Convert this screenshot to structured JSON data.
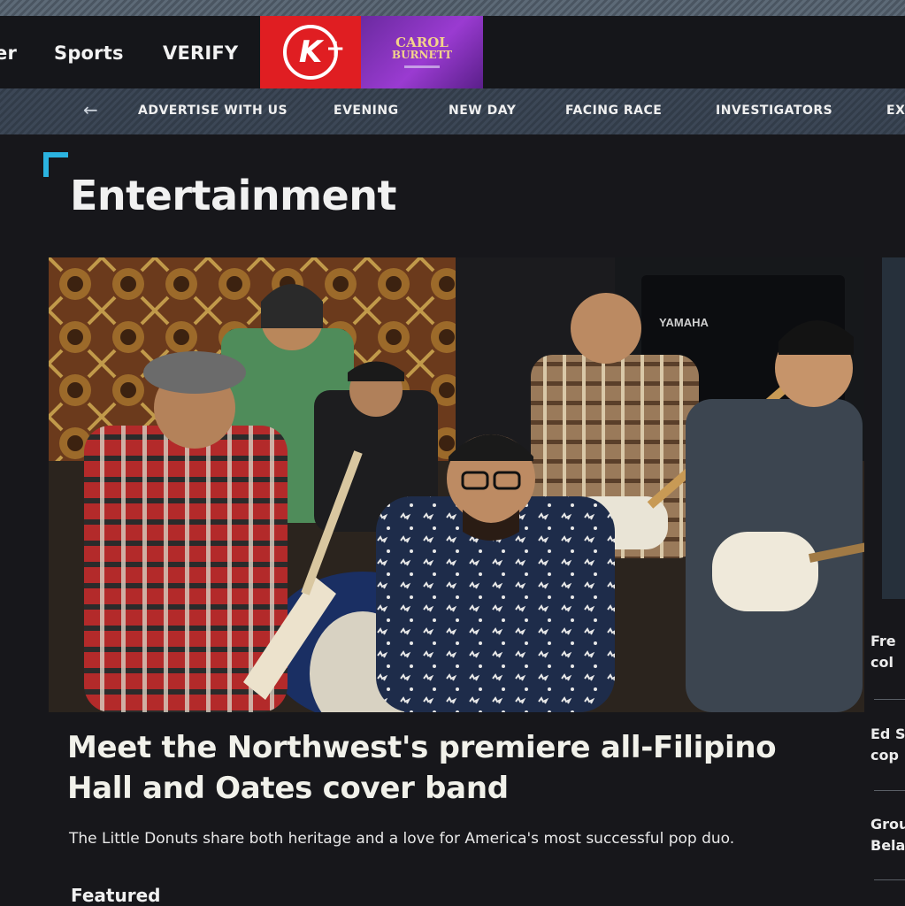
{
  "main_nav": {
    "cut_item": "er",
    "items": [
      "Sports",
      "VERIFY"
    ],
    "kplus_label": "K",
    "kplus_plus": "+",
    "promo_line1": "CAROL",
    "promo_line2": "BURNETT"
  },
  "sub_nav": {
    "items": [
      "ADVERTISE WITH US",
      "EVENING",
      "NEW DAY",
      "FACING RACE",
      "INVESTIGATORS",
      "EX"
    ]
  },
  "section": {
    "title": "Entertainment"
  },
  "article": {
    "headline": "Meet the Northwest's premiere all-Filipino Hall and Oates cover band",
    "dek": "The Little Donuts share both heritage and a love for America's most successful pop duo."
  },
  "featured_label": "Featured",
  "sidebar": {
    "items": [
      {
        "line1": "Fre",
        "line2": "col"
      },
      {
        "line1": "Ed S",
        "line2": "cop"
      },
      {
        "line1": "Grou",
        "line2": "Bela"
      }
    ]
  },
  "hero_photo": {
    "amp_brand": "YAMAHA"
  }
}
